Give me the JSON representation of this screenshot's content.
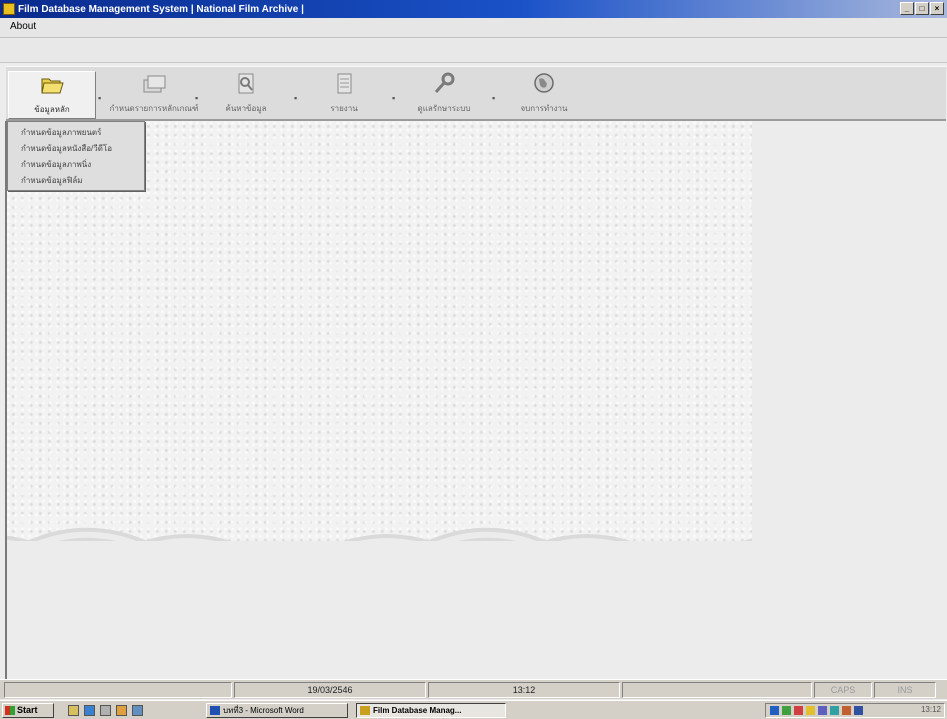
{
  "window": {
    "title": "Film Database Management System  |  National Film Archive  |"
  },
  "menu": {
    "items": [
      "About"
    ]
  },
  "toolbar": {
    "buttons": [
      {
        "label": "ข้อมูลหลัก",
        "icon": "folder-icon"
      },
      {
        "label": "กำหนดรายการหลักเกณฑ์",
        "icon": "cards-icon"
      },
      {
        "label": "ค้นหาข้อมูล",
        "icon": "search-document-icon"
      },
      {
        "label": "รายงาน",
        "icon": "report-icon"
      },
      {
        "label": "ดูแลรักษาระบบ",
        "icon": "wrench-icon"
      },
      {
        "label": "จบการทำงาน",
        "icon": "globe-icon"
      }
    ]
  },
  "dropdown": {
    "items": [
      "กำหนดข้อมูลภาพยนตร์",
      "กำหนดข้อมูลหนังสือ/วีดีโอ",
      "กำหนดข้อมูลภาพนิ่ง",
      "กำหนดข้อมูลฟิล์ม"
    ]
  },
  "status": {
    "date": "19/03/2546",
    "time": "13:12",
    "caps": "CAPS",
    "ins": "INS"
  },
  "taskbar": {
    "start": "Start",
    "tasks": [
      "บทที่3 - Microsoft Word",
      "Film Database Manag..."
    ],
    "clock": "13:12"
  }
}
